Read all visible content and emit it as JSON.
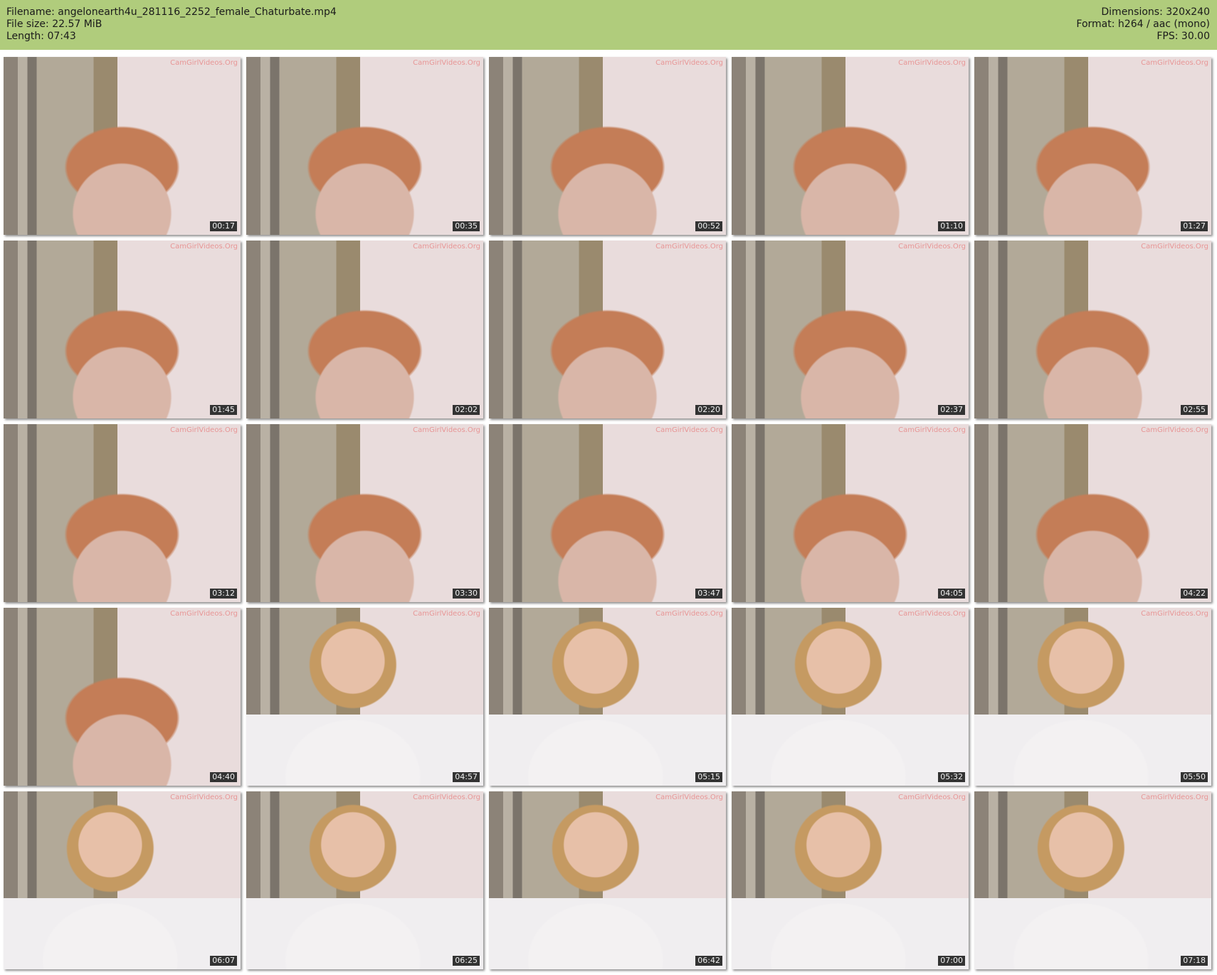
{
  "header": {
    "filename": "Filename: angelonearth4u_281116_2252_female_Chaturbate.mp4",
    "file_size": "File size: 22.57 MiB",
    "length": "Length: 07:43",
    "dimensions": "Dimensions: 320x240",
    "format": "Format: h264 / aac (mono)",
    "fps": "FPS: 30.00"
  },
  "watermark": "CamGirlVideos.Org",
  "thumbnails": [
    {
      "time": "00:17",
      "scene": "close"
    },
    {
      "time": "00:35",
      "scene": "close"
    },
    {
      "time": "00:52",
      "scene": "close"
    },
    {
      "time": "01:10",
      "scene": "close"
    },
    {
      "time": "01:27",
      "scene": "close"
    },
    {
      "time": "01:45",
      "scene": "close"
    },
    {
      "time": "02:02",
      "scene": "close"
    },
    {
      "time": "02:20",
      "scene": "close"
    },
    {
      "time": "02:37",
      "scene": "close"
    },
    {
      "time": "02:55",
      "scene": "close"
    },
    {
      "time": "03:12",
      "scene": "close"
    },
    {
      "time": "03:30",
      "scene": "close"
    },
    {
      "time": "03:47",
      "scene": "close"
    },
    {
      "time": "04:05",
      "scene": "close"
    },
    {
      "time": "04:22",
      "scene": "close"
    },
    {
      "time": "04:40",
      "scene": "close"
    },
    {
      "time": "04:57",
      "scene": "wide"
    },
    {
      "time": "05:15",
      "scene": "wide"
    },
    {
      "time": "05:32",
      "scene": "wide"
    },
    {
      "time": "05:50",
      "scene": "wide"
    },
    {
      "time": "06:07",
      "scene": "wide"
    },
    {
      "time": "06:25",
      "scene": "wide"
    },
    {
      "time": "06:42",
      "scene": "wide"
    },
    {
      "time": "07:00",
      "scene": "wide"
    },
    {
      "time": "07:18",
      "scene": "wide"
    }
  ]
}
